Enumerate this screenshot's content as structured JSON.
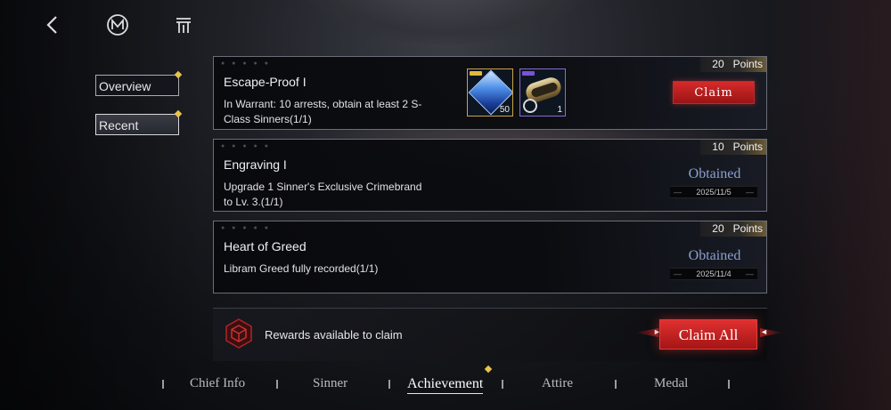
{
  "top_bar": {
    "back_icon": "chevron-left-icon",
    "logo_icon": "m-logo-icon",
    "rank_icon": "pillars-icon"
  },
  "side_tabs": [
    {
      "label": "Overview",
      "active": false,
      "badge": true
    },
    {
      "label": "Recent",
      "active": true,
      "badge": true
    }
  ],
  "achievements": [
    {
      "title": "Escape-Proof I",
      "description": "In Warrant: 10 arrests, obtain at least 2 S-Class Sinners(1/1)",
      "points": "20",
      "points_label": "Points",
      "status": "claimable",
      "action_label": "Claim",
      "rewards": [
        {
          "icon": "blue-crystal-icon",
          "rarity_color": "#e1b73c",
          "qty": "50"
        },
        {
          "icon": "golden-scroll-icon",
          "rarity_color": "#7a52d8",
          "qty": "1"
        }
      ]
    },
    {
      "title": "Engraving I",
      "description": "Upgrade 1 Sinner's Exclusive Crimebrand to Lv. 3.(1/1)",
      "points": "10",
      "points_label": "Points",
      "status": "obtained",
      "status_label": "Obtained",
      "date": "2025/11/5"
    },
    {
      "title": "Heart of Greed",
      "description": "Libram Greed fully recorded(1/1)",
      "points": "20",
      "points_label": "Points",
      "status": "obtained",
      "status_label": "Obtained",
      "date": "2025/11/4"
    }
  ],
  "claim_bar": {
    "icon": "red-cube-icon",
    "message": "Rewards available to claim",
    "button_label": "Claim All"
  },
  "bottom_nav": [
    {
      "label": "Chief Info",
      "active": false
    },
    {
      "label": "Sinner",
      "active": false
    },
    {
      "label": "Achievement",
      "active": true
    },
    {
      "label": "Attire",
      "active": false
    },
    {
      "label": "Medal",
      "active": false
    }
  ],
  "colors": {
    "accent_red": "#c81e1e",
    "badge_gold": "#e9c44a",
    "obtained_blue": "#8aa0cf"
  }
}
